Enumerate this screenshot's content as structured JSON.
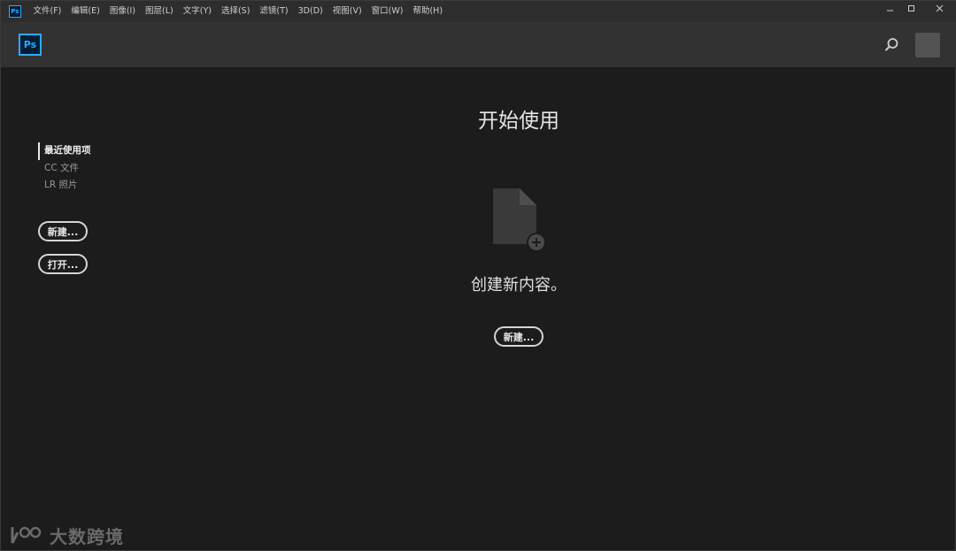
{
  "menubar": {
    "app_icon_text": "Ps",
    "items": [
      "文件(F)",
      "编辑(E)",
      "图像(I)",
      "图层(L)",
      "文字(Y)",
      "选择(S)",
      "滤镜(T)",
      "3D(D)",
      "视图(V)",
      "窗口(W)",
      "帮助(H)"
    ],
    "window_controls": [
      "minimize-icon",
      "maximize-icon",
      "close-icon"
    ]
  },
  "header": {
    "logo_text": "Ps",
    "search_icon": "search-icon"
  },
  "sidebar": {
    "links": [
      "最近使用项",
      "CC 文件",
      "LR 照片"
    ],
    "new_button": "新建...",
    "open_button": "打开..."
  },
  "main": {
    "title": "开始使用",
    "create_text": "创建新内容。",
    "new_button": "新建...",
    "doc_icon": "new-document-icon"
  },
  "watermark": {
    "text": "大数跨境"
  },
  "colors": {
    "background": "#1c1c1c",
    "header": "#323232",
    "menubar": "#2d2d2d",
    "ps_accent": "#31a8ff"
  }
}
